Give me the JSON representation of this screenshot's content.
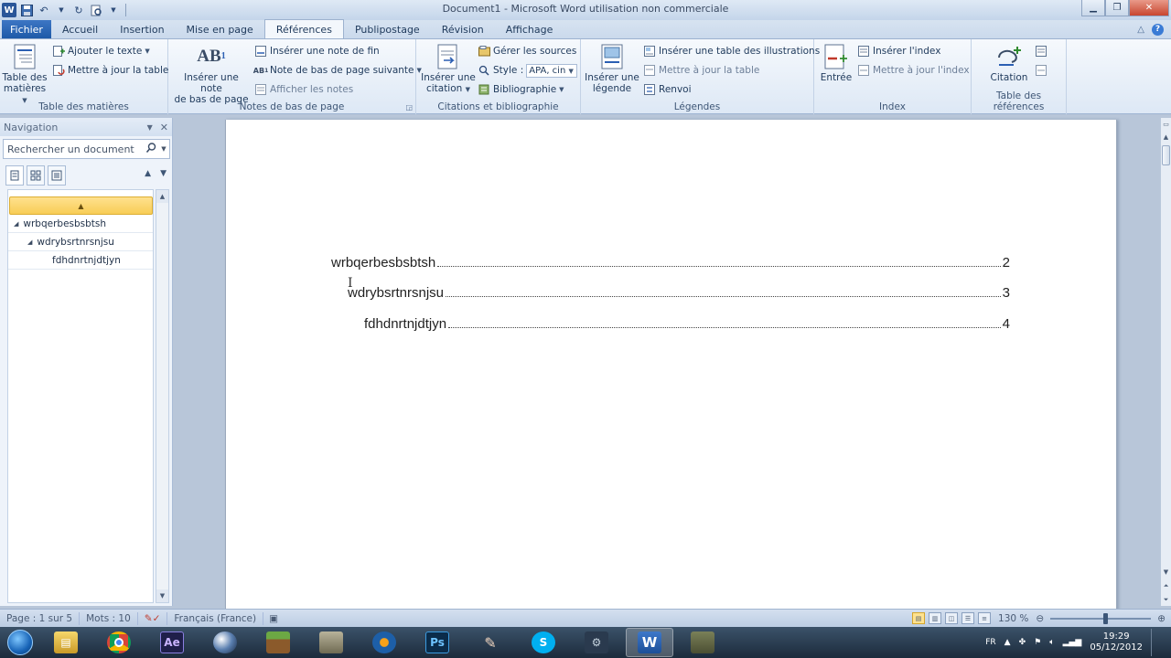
{
  "window": {
    "title": "Document1 - Microsoft Word utilisation non commerciale"
  },
  "tabs": [
    {
      "label": "Fichier"
    },
    {
      "label": "Accueil"
    },
    {
      "label": "Insertion"
    },
    {
      "label": "Mise en page"
    },
    {
      "label": "Références"
    },
    {
      "label": "Publipostage"
    },
    {
      "label": "Révision"
    },
    {
      "label": "Affichage"
    }
  ],
  "ribbon": {
    "toc": {
      "big_line1": "Table des",
      "big_line2": "matières",
      "add_text": "Ajouter le texte",
      "update_table": "Mettre à jour la table",
      "label": "Table des matières"
    },
    "footnotes": {
      "big_line1": "Insérer une note",
      "big_line2": "de bas de page",
      "insert_endnote": "Insérer une note de fin",
      "next_footnote": "Note de bas de page suivante",
      "show_notes": "Afficher les notes",
      "label": "Notes de bas de page"
    },
    "citations": {
      "big_line1": "Insérer une",
      "big_line2": "citation",
      "manage_sources": "Gérer les sources",
      "style_label": "Style :",
      "style_value": "APA, cin",
      "bibliography": "Bibliographie",
      "label": "Citations et bibliographie"
    },
    "captions": {
      "big_line1": "Insérer une",
      "big_line2": "légende",
      "insert_figures_table": "Insérer une table des illustrations",
      "update_table": "Mettre à jour la table",
      "cross_ref": "Renvoi",
      "label": "Légendes"
    },
    "index": {
      "big": "Entrée",
      "insert_index": "Insérer l'index",
      "update_index": "Mettre à jour l'index",
      "label": "Index"
    },
    "authorities": {
      "big": "Citation",
      "label": "Table des références"
    }
  },
  "navigation": {
    "title": "Navigation",
    "search_placeholder": "Rechercher un document",
    "headings": [
      {
        "text": "wrbqerbesbsbtsh"
      },
      {
        "text": "wdrybsrtnrsnjsu"
      },
      {
        "text": "fdhdnrtnjdtjyn"
      }
    ]
  },
  "document": {
    "toc": [
      {
        "text": "wrbqerbesbsbtsh",
        "page": "2",
        "level": 1
      },
      {
        "text": "wdrybsrtnrsnjsu",
        "page": "3",
        "level": 2
      },
      {
        "text": "fdhdnrtnjdtjyn",
        "page": "4",
        "level": 3
      }
    ]
  },
  "statusbar": {
    "page": "Page : 1 sur 5",
    "words": "Mots : 10",
    "language": "Français (France)",
    "zoom": "130 %"
  },
  "taskbar": {
    "lang": "FR",
    "time": "19:29",
    "date": "05/12/2012"
  }
}
